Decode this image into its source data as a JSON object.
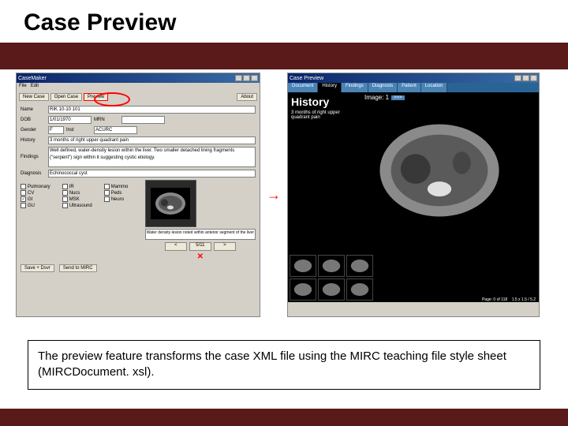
{
  "slide": {
    "title": "Case Preview",
    "caption": "The preview feature transforms the case XML file using the MIRC teaching file style sheet (MIRCDocument. xsl)."
  },
  "left": {
    "app_title": "CaseMaker",
    "menu": {
      "file": "File",
      "edit": "Edit"
    },
    "toolbar": {
      "new": "New Case",
      "open": "Open Case",
      "preview": "Preview",
      "about": "About"
    },
    "labels": {
      "name": "Name",
      "dob": "DOB",
      "mrn": "MRN",
      "gender": "Gender",
      "inst": "Inst",
      "history": "History",
      "findings": "Findings",
      "diagnosis": "Diagnosis"
    },
    "values": {
      "name": "RIK 10-10 101",
      "dob": "1/01/1970",
      "mrn": "",
      "gender": "F",
      "inst": "ACURC",
      "history": "3 months of right upper quadrant pain",
      "findings": "Well defined, water-density lesion within the liver. Two smaller detached lining fragments (\"serpent\") sign within it suggesting cystic etiology.",
      "diagnosis": "Echinococcal cyst"
    },
    "checks": {
      "col1": [
        "Pulmonary",
        "CV",
        "GI",
        "GU"
      ],
      "col2": [
        "IR",
        "Nucs",
        "MSK",
        "Ultrasound"
      ],
      "col3": [
        "Mammo",
        "Peds",
        "Neuro"
      ],
      "checked": [
        "GI"
      ]
    },
    "note": "Water density lesion noted within anterior segment of the liver",
    "image_counter": "5/11",
    "buttons": {
      "save": "Save + Dsvr",
      "send": "Send to MIRC"
    }
  },
  "right": {
    "app_title": "Case Preview",
    "tabs": [
      "Document",
      "History",
      "Findings",
      "Diagnosis",
      "Patient",
      "Location"
    ],
    "active_tab": "History",
    "history_title": "History",
    "history_text": "3 months of right upper quadrant pain",
    "image_label": "Image: 1",
    "next": ">>>",
    "page_info_left": "Page: 0 of 118",
    "page_info_right": "1.5 x 1.5 / 5.2"
  }
}
